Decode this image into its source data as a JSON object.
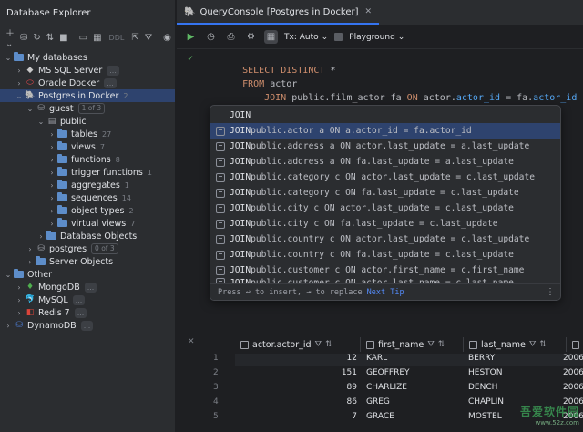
{
  "explorer": {
    "title": "Database Explorer",
    "toolbar": {
      "ddl_label": "DDL"
    },
    "tree": [
      {
        "label": "My databases",
        "count": "",
        "badge": ""
      },
      {
        "label": "MS SQL Server",
        "count": "",
        "badge": "..."
      },
      {
        "label": "Oracle Docker",
        "count": "",
        "badge": "..."
      },
      {
        "label": "Postgres in Docker",
        "count": "2",
        "badge": ""
      },
      {
        "label": "guest",
        "count": "",
        "badge": "1 of 3"
      },
      {
        "label": "public",
        "count": "",
        "badge": ""
      },
      {
        "label": "tables",
        "count": "27",
        "badge": ""
      },
      {
        "label": "views",
        "count": "7",
        "badge": ""
      },
      {
        "label": "functions",
        "count": "8",
        "badge": ""
      },
      {
        "label": "trigger functions",
        "count": "1",
        "badge": ""
      },
      {
        "label": "aggregates",
        "count": "1",
        "badge": ""
      },
      {
        "label": "sequences",
        "count": "14",
        "badge": ""
      },
      {
        "label": "object types",
        "count": "2",
        "badge": ""
      },
      {
        "label": "virtual views",
        "count": "7",
        "badge": ""
      },
      {
        "label": "Database Objects",
        "count": "",
        "badge": ""
      },
      {
        "label": "postgres",
        "count": "",
        "badge": "0 of 3"
      },
      {
        "label": "Server Objects",
        "count": "",
        "badge": ""
      },
      {
        "label": "Other",
        "count": "",
        "badge": ""
      },
      {
        "label": "MongoDB",
        "count": "",
        "badge": "..."
      },
      {
        "label": "MySQL",
        "count": "",
        "badge": "..."
      },
      {
        "label": "Redis 7",
        "count": "",
        "badge": "..."
      },
      {
        "label": "DynamoDB",
        "count": "",
        "badge": "..."
      }
    ]
  },
  "editor_tab": {
    "title": "QueryConsole [Postgres in Docker]"
  },
  "editor_toolbar": {
    "tx_label": "Tx: Auto",
    "schema_label": "Playground"
  },
  "code": {
    "line1": {
      "kw": "SELECT DISTINCT",
      "rest": " *"
    },
    "line2": {
      "kw": "FROM",
      "rest": " actor"
    },
    "line3": {
      "kw": "JOIN",
      "table": " public.film_actor fa ",
      "on": "ON",
      "a": " actor",
      "af": "actor_id",
      "eq": " = fa.",
      "bf": "actor_id"
    }
  },
  "completion": {
    "items": [
      {
        "kw": "JOIN",
        "rest": ""
      },
      {
        "kw": "JOIN",
        "rest": " public.actor a ON a.actor_id = fa.actor_id"
      },
      {
        "kw": "JOIN",
        "rest": " public.address a ON actor.last_update = a.last_update"
      },
      {
        "kw": "JOIN",
        "rest": " public.address a ON fa.last_update = a.last_update"
      },
      {
        "kw": "JOIN",
        "rest": " public.category c ON actor.last_update = c.last_update"
      },
      {
        "kw": "JOIN",
        "rest": " public.category c ON fa.last_update = c.last_update"
      },
      {
        "kw": "JOIN",
        "rest": " public.city c ON actor.last_update = c.last_update"
      },
      {
        "kw": "JOIN",
        "rest": " public.city c ON fa.last_update = c.last_update"
      },
      {
        "kw": "JOIN",
        "rest": " public.country c ON actor.last_update = c.last_update"
      },
      {
        "kw": "JOIN",
        "rest": " public.country c ON fa.last_update = c.last_update"
      },
      {
        "kw": "JOIN",
        "rest": " public.customer c ON actor.first_name = c.first_name"
      },
      {
        "kw": "JOIN",
        "rest": " public.customer c ON actor.last_name = c.last_name"
      }
    ],
    "footer": {
      "hint": "Press ↩ to insert, ⇥ to replace",
      "next_tip": "Next Tip"
    }
  },
  "grid": {
    "columns": [
      "actor.actor_id",
      "first_name",
      "last_name",
      ""
    ],
    "rows": [
      {
        "n": "1",
        "id": "12",
        "first": "KARL",
        "last": "BERRY",
        "extra": "2006"
      },
      {
        "n": "2",
        "id": "151",
        "first": "GEOFFREY",
        "last": "HESTON",
        "extra": "2006"
      },
      {
        "n": "3",
        "id": "89",
        "first": "CHARLIZE",
        "last": "DENCH",
        "extra": "2006"
      },
      {
        "n": "4",
        "id": "86",
        "first": "GREG",
        "last": "CHAPLIN",
        "extra": "2006"
      },
      {
        "n": "5",
        "id": "7",
        "first": "GRACE",
        "last": "MOSTEL",
        "extra": "2006"
      }
    ]
  },
  "watermark": {
    "cn": "吾爱软件园",
    "url": "www.52z.com"
  },
  "colors": {
    "accent": "#3574f0",
    "selection": "#2e436e",
    "keyword": "#cf8e6d",
    "field": "#56a8f5",
    "run": "#5fb865"
  }
}
